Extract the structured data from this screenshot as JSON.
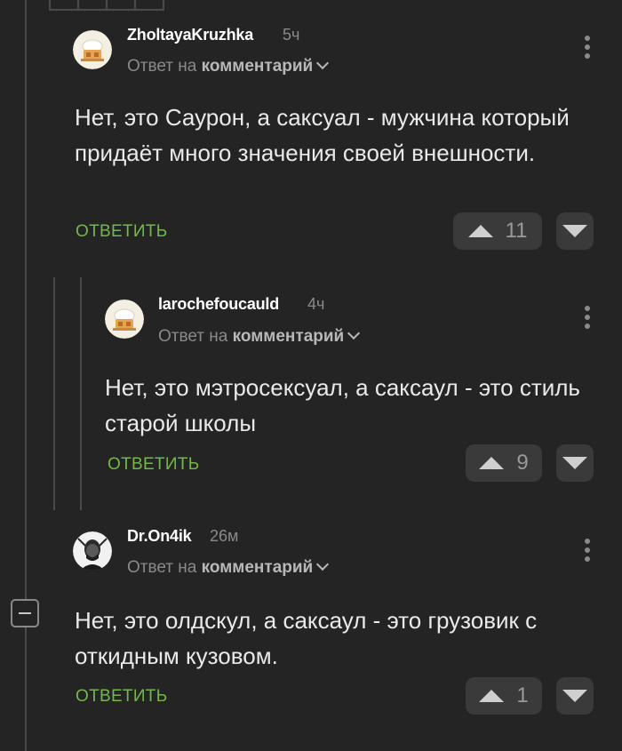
{
  "comments": [
    {
      "username": "ZholtayaKruzhka",
      "time": "5ч",
      "reply_prefix": "Ответ на",
      "reply_target": "комментарий",
      "text": "Нет, это Саурон, а саксуал - мужчина который придаёт много значения своей внешности.",
      "reply_label": "ОТВЕТИТЬ",
      "votes": "11",
      "avatar_icon": "chef-hat-avatar-icon"
    },
    {
      "username": "larochefoucauld",
      "time": "4ч",
      "reply_prefix": "Ответ на",
      "reply_target": "комментарий",
      "text": "Нет, это мэтросексуал, а саксаул - это стиль старой школы",
      "reply_label": "ОТВЕТИТЬ",
      "votes": "9",
      "avatar_icon": "chef-hat-avatar-icon"
    },
    {
      "username": "Dr.On4ik",
      "time": "26м",
      "reply_prefix": "Ответ на",
      "reply_target": "комментарий",
      "text": "Нет, это олдскул, а саксаул - это грузовик с откидным кузовом.",
      "reply_label": "ОТВЕТИТЬ",
      "votes": "1",
      "avatar_icon": "man-portrait-avatar-icon"
    }
  ],
  "colors": {
    "background": "#242424",
    "reply_green": "#74b84a",
    "vote_bg": "#3a3a3a",
    "thread_line": "#4a4a4a"
  }
}
